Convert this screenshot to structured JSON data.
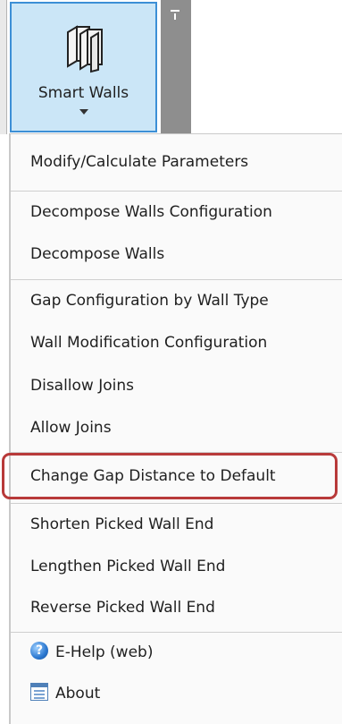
{
  "ribbon": {
    "button_label": "Smart Walls",
    "icon": "smart-walls-icon",
    "accent_color": "#3c8fd6",
    "button_bg": "#cbe6f7"
  },
  "menu": {
    "items": [
      {
        "label": "Modify/Calculate Parameters"
      },
      {
        "label": "Decompose Walls Configuration"
      },
      {
        "label": "Decompose Walls"
      },
      {
        "label": "Gap Configuration by Wall Type"
      },
      {
        "label": "Wall Modification Configuration"
      },
      {
        "label": "Disallow Joins"
      },
      {
        "label": "Allow Joins"
      },
      {
        "label": "Change Gap Distance to Default",
        "highlighted": true
      },
      {
        "label": "Shorten Picked Wall End"
      },
      {
        "label": "Lengthen Picked Wall End"
      },
      {
        "label": "Reverse Picked Wall End"
      },
      {
        "label": "E-Help (web)",
        "icon": "help-icon"
      },
      {
        "label": "About",
        "icon": "about-icon"
      }
    ],
    "highlight_color": "#b83a3a"
  }
}
